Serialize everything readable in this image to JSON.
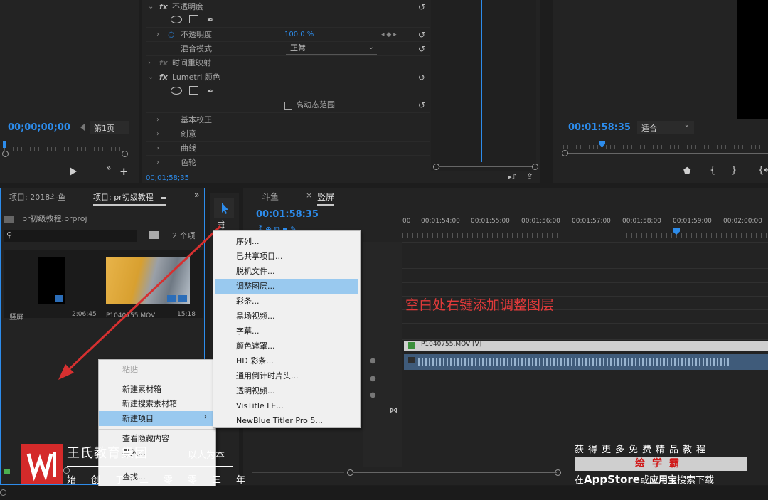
{
  "effects": {
    "opacity_header": "不透明度",
    "opacity_label": "不透明度",
    "opacity_value": "100.0 %",
    "blend_label": "混合模式",
    "blend_value": "正常",
    "time_remap": "时间重映射",
    "lumetri": "Lumetri 颜色",
    "hdr_label": "高动态范围",
    "basic_correction": "基本校正",
    "creative": "创意",
    "curves": "曲线",
    "color_wheels": "色轮",
    "timecode": "00;01;58;35"
  },
  "source": {
    "timecode": "00;00;00;00",
    "page": "第1页"
  },
  "program": {
    "timecode": "00:01:58:35",
    "fit": "适合"
  },
  "project": {
    "tab1": "项目: 2018斗鱼",
    "tab2": "项目: pr初级教程",
    "file": "pr初级教程.prproj",
    "count": "2 个项",
    "item1_name": "竖屏",
    "item1_dur": "2:06:45",
    "item2_name": "P1040755.MOV",
    "item2_dur": "15:18"
  },
  "timeline": {
    "tab1": "斗鱼",
    "tab2": "竖屏",
    "timecode": "00:01:58:35",
    "ruler": [
      "00:01:54:00",
      "00:01:55:00",
      "00:01:56:00",
      "00:01:57:00",
      "00:01:58:00",
      "00:01:59:00",
      "00:02:00:00"
    ],
    "ruler_prefix": "00",
    "clip_label": "P1040755.MOV [V]",
    "annotation": "空白处右键添加调整图层"
  },
  "context_menu": {
    "items": [
      "粘贴",
      "新建素材箱",
      "新建搜索素材箱",
      "新建项目",
      "查看隐藏内容",
      "导入...",
      "查找..."
    ]
  },
  "submenu": {
    "items": [
      "序列...",
      "已共享项目...",
      "脱机文件...",
      "调整图层...",
      "彩条...",
      "黑场视频...",
      "字幕...",
      "颜色遮罩...",
      "HD 彩条...",
      "通用倒计时片头...",
      "透明视频...",
      "VisTitle LE...",
      "NewBlue Titler Pro 5..."
    ]
  },
  "watermark_left": {
    "brand": "王氏教育集团",
    "motto": "以人为本",
    "tagline": "始创于二零零三年"
  },
  "watermark_right": {
    "line1": "获得更多免费精品教程",
    "app": "绘学霸",
    "line3_prefix": "在",
    "line3_appstore": "AppStore",
    "line3_or": "或",
    "line3_yyb": "应用宝",
    "line3_suffix": "搜索下载"
  },
  "colors": {
    "accent": "#2d8ceb",
    "menu_highlight": "#99c9ef",
    "annotation": "#e03a3a",
    "arrow": "#d63030",
    "logo": "#d42a2a"
  }
}
